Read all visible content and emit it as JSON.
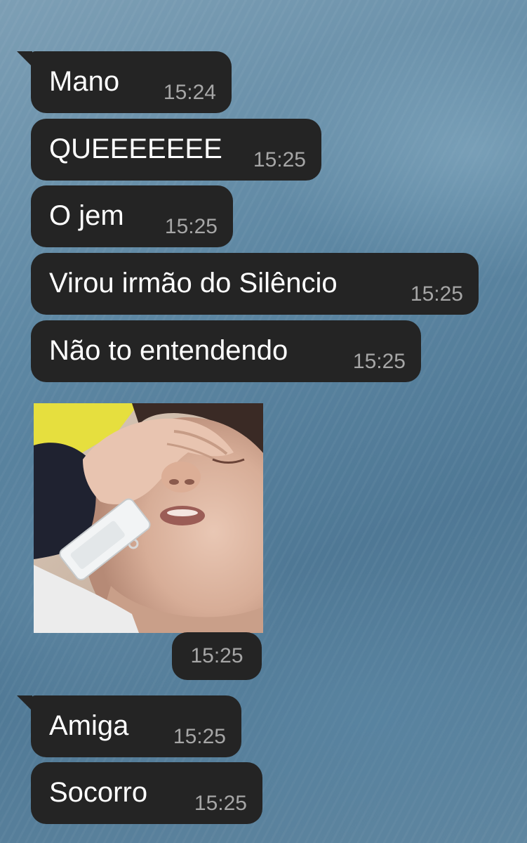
{
  "messages": [
    {
      "text": "Mano",
      "time": "15:24"
    },
    {
      "text": "QUEEEEEEE",
      "time": "15:25"
    },
    {
      "text": "O jem",
      "time": "15:25"
    },
    {
      "text": "Virou irmão do Silêncio",
      "time": "15:25"
    },
    {
      "text": "Não to entendendo",
      "time": "15:25"
    },
    {
      "text": "Amiga",
      "time": "15:25"
    },
    {
      "text": "Socorro",
      "time": "15:25"
    }
  ],
  "photo_message": {
    "time": "15:25"
  },
  "colors": {
    "bubble": "#242424",
    "message_text": "#ffffff",
    "timestamp": "#a6a6a6",
    "wallpaper": "#5d87a3"
  }
}
